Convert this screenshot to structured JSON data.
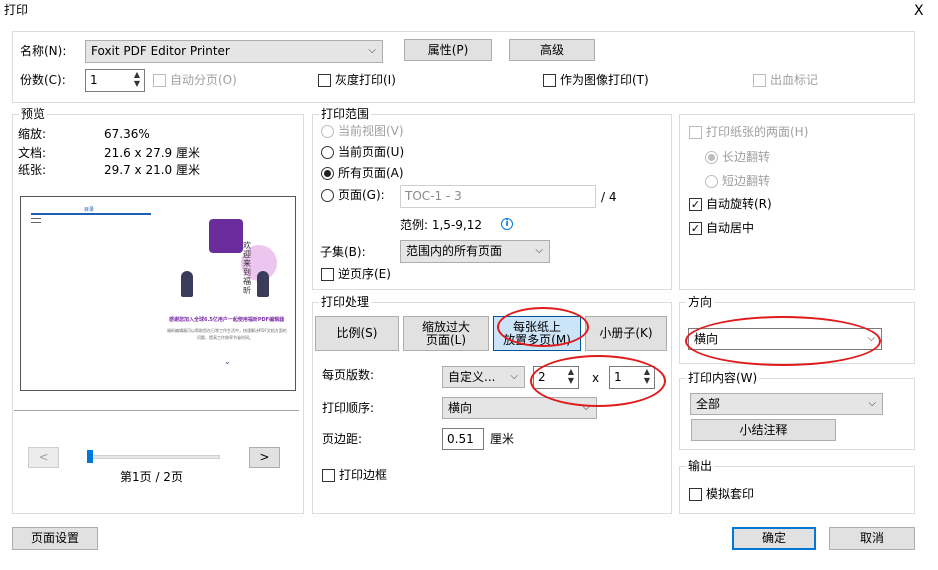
{
  "title": "打印",
  "close": "X",
  "printer": {
    "name_label": "名称(N):",
    "name_value": "Foxit PDF Editor Printer",
    "properties": "属性(P)",
    "advanced": "高级",
    "copies_label": "份数(C):",
    "copies_value": "1",
    "collate": "自动分页(O)",
    "grayscale": "灰度打印(I)",
    "as_image": "作为图像打印(T)",
    "bleed": "出血标记"
  },
  "preview": {
    "legend": "预览",
    "zoom_label": "缩放:",
    "zoom_value": "67.36%",
    "doc_label": "文档:",
    "doc_value": "21.6 x 27.9 厘米",
    "paper_label": "纸张:",
    "paper_value": "29.7 x 21.0 厘米",
    "prev": "<",
    "next": ">",
    "page_info": "第1页 / 2页",
    "thumb_heading": "欢迎来到福昕",
    "thumb_line1": "感谢您加入全球6.5亿用户一起使用福昕PDF编辑器",
    "thumb_line2": "福昕编辑器可以帮助您在日常工作生活中，快速解决PDF文档方面的",
    "thumb_line3": "问题，提高工作效率节省时间。",
    "thumb_mini": "目录"
  },
  "range": {
    "legend": "打印范围",
    "current_view": "当前视图(V)",
    "current_page": "当前页面(U)",
    "all_pages": "所有页面(A)",
    "pages": "页面(G):",
    "pages_value": "TOC-1 - 3",
    "pages_total": "/ 4",
    "example": "范例: 1,5-9,12",
    "subset_label": "子集(B):",
    "subset_value": "范围内的所有页面",
    "reverse": "逆页序(E)"
  },
  "handling": {
    "legend": "打印处理",
    "tabs": [
      {
        "l1": "比例(S)",
        "l2": ""
      },
      {
        "l1": "缩放过大",
        "l2": "页面(L)"
      },
      {
        "l1": "每张纸上",
        "l2": "放置多页(M)"
      },
      {
        "l1": "小册子(K)",
        "l2": ""
      }
    ],
    "pages_per_sheet_label": "每页版数:",
    "pages_per_sheet_value": "自定义...",
    "cols": "2",
    "x": "x",
    "rows": "1",
    "order_label": "打印顺序:",
    "order_value": "横向",
    "margin_label": "页边距:",
    "margin_value": "0.51",
    "margin_unit": "厘米",
    "border": "打印边框"
  },
  "duplex": {
    "both_sides": "打印纸张的两面(H)",
    "long_edge": "长边翻转",
    "short_edge": "短边翻转",
    "auto_rotate": "自动旋转(R)",
    "auto_center": "自动居中"
  },
  "orientation": {
    "legend": "方向",
    "value": "横向"
  },
  "content": {
    "legend": "打印内容(W)",
    "value": "全部",
    "summarize": "小结注释"
  },
  "output": {
    "legend": "输出",
    "simulate": "模拟套印"
  },
  "footer": {
    "page_setup": "页面设置",
    "ok": "确定",
    "cancel": "取消"
  },
  "colors": {
    "accent": "#0078d7",
    "annotation": "#e11b1b",
    "thumb_purple": "#7b2fa8"
  }
}
